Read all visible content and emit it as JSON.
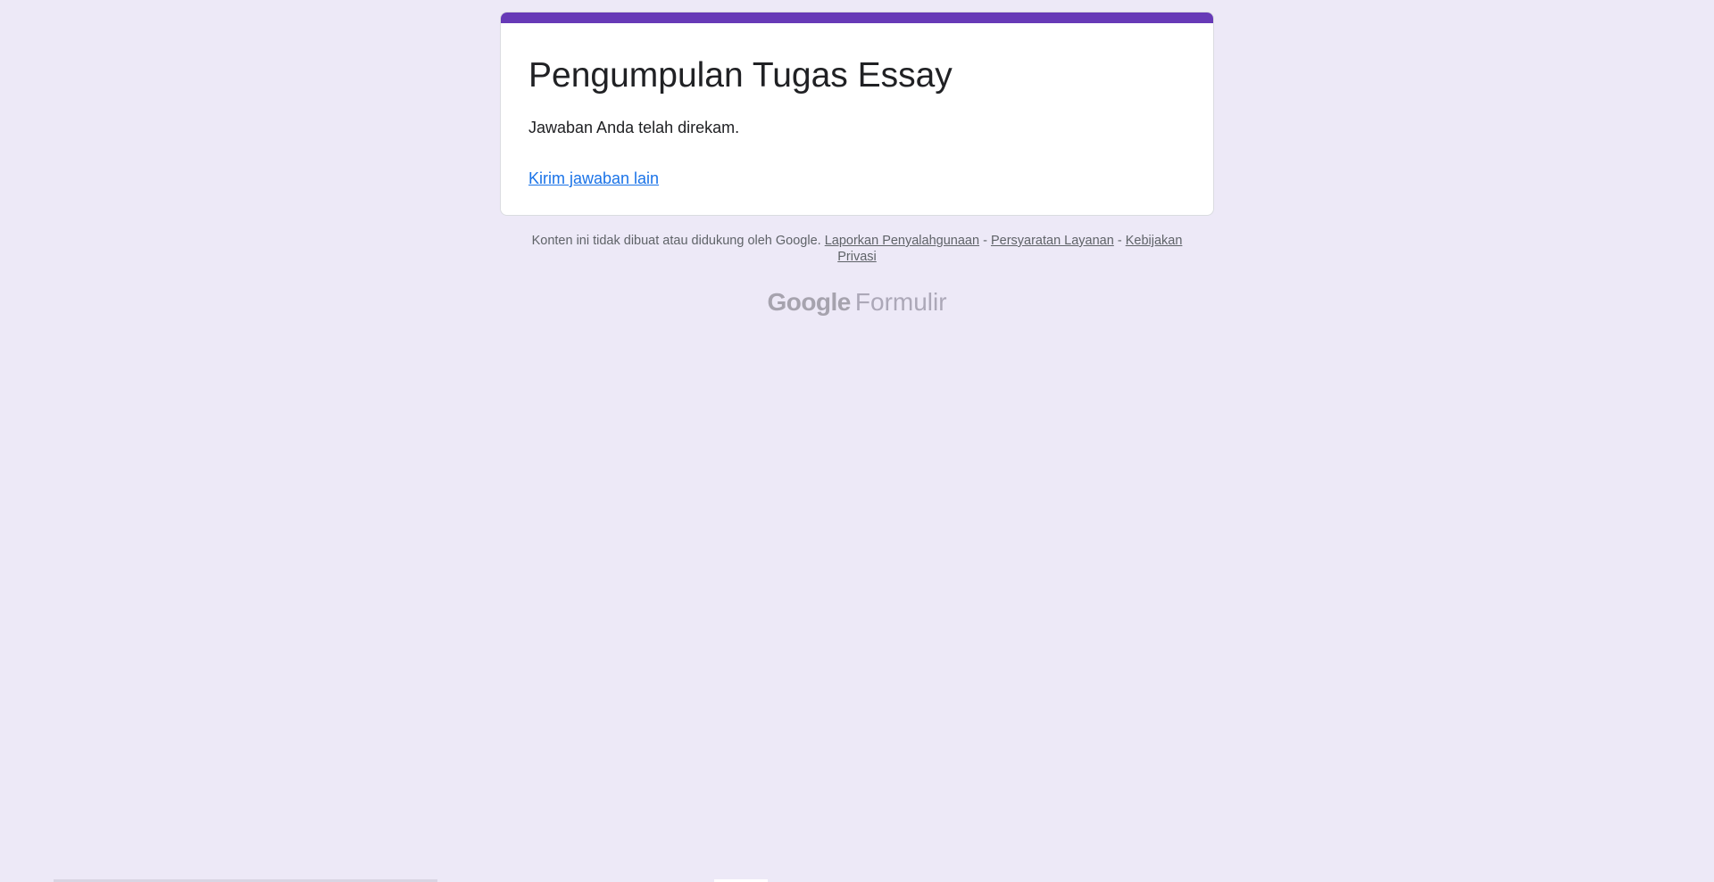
{
  "form": {
    "title": "Pengumpulan Tugas Essay",
    "confirmation_message": "Jawaban Anda telah direkam.",
    "submit_another_label": "Kirim jawaban lain"
  },
  "footer": {
    "disclaimer": "Konten ini tidak dibuat atau didukung oleh Google.",
    "report_abuse_label": "Laporkan Penyalahgunaan",
    "separator": "-",
    "terms_label": "Persyaratan Layanan",
    "privacy_label": "Kebijakan Privasi"
  },
  "brand": {
    "google_label": "Google",
    "product_label": "Formulir"
  },
  "colors": {
    "accent": "#673ab7",
    "background": "#ede9f7",
    "link": "#1a73e8"
  }
}
